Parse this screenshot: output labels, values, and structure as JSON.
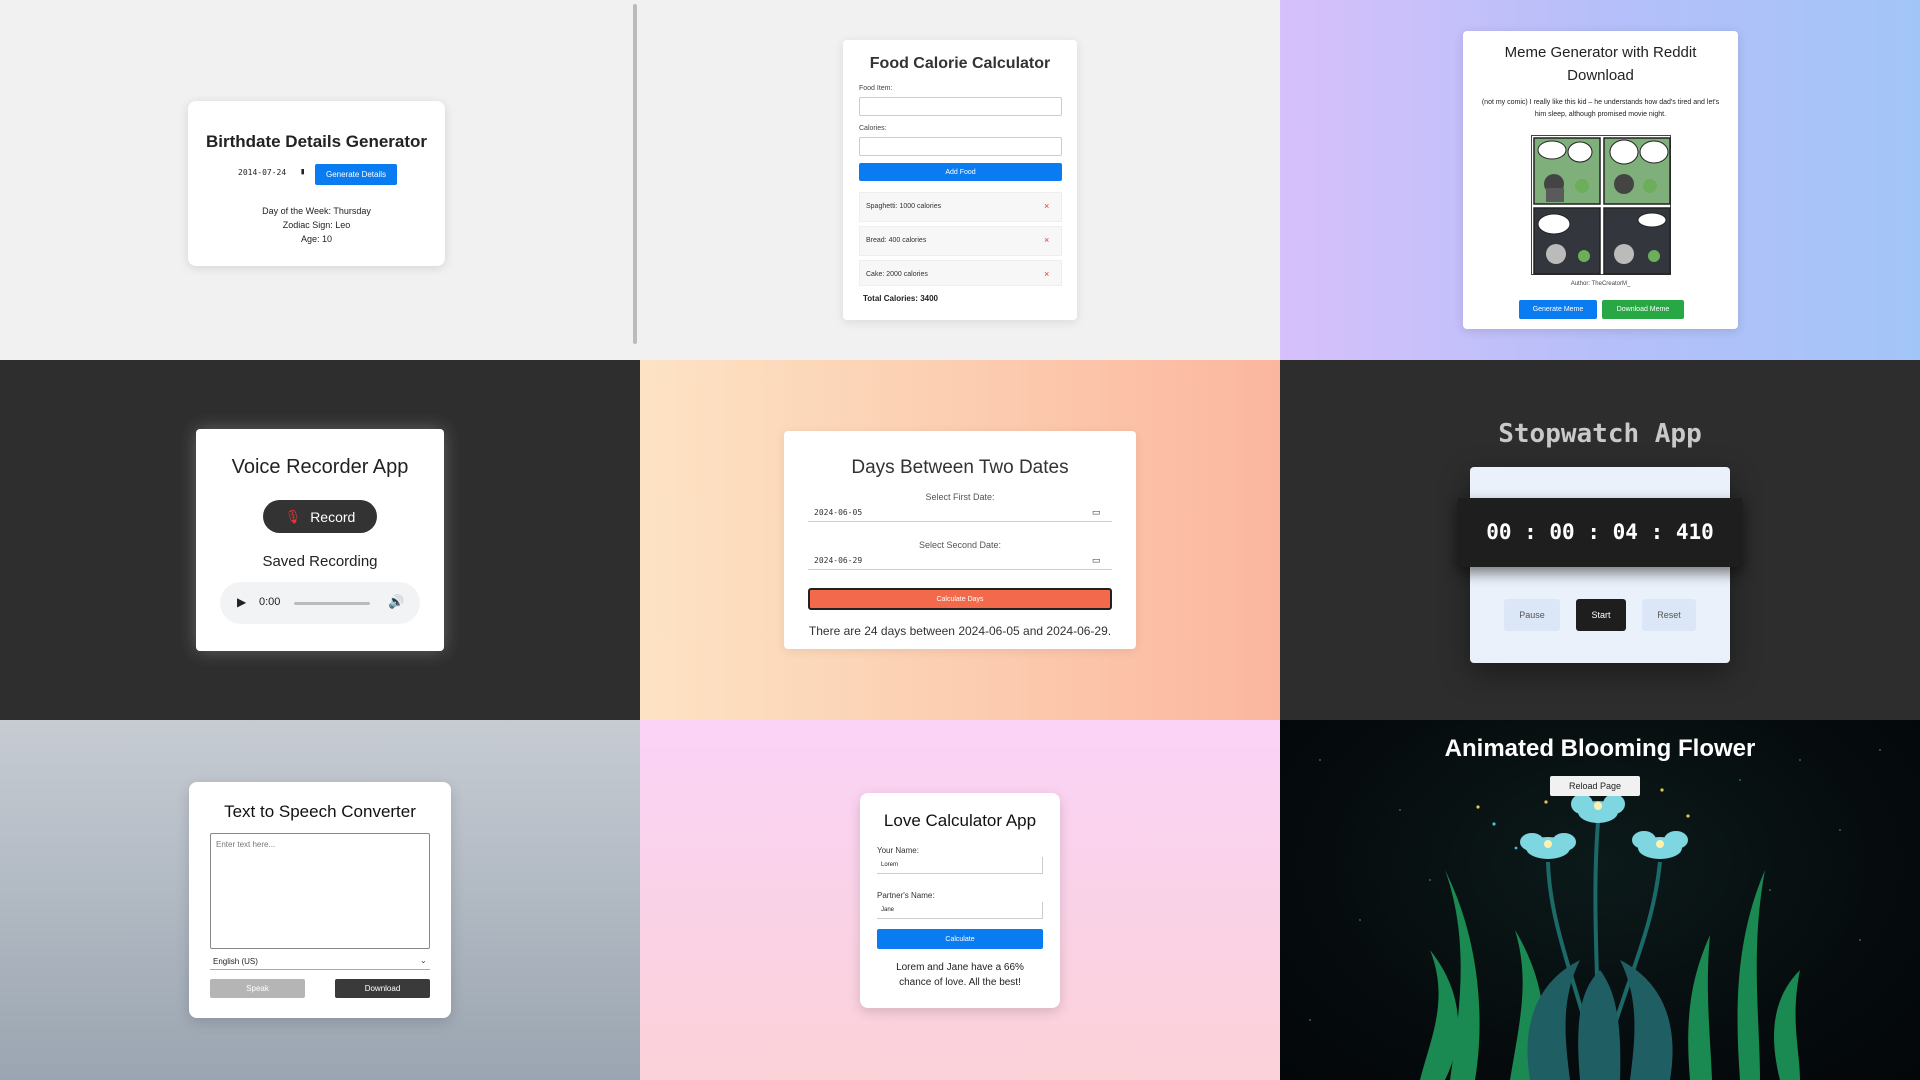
{
  "birthdate": {
    "title": "Birthdate Details Generator",
    "date_value": "2014-07-24",
    "generate_label": "Generate Details",
    "day_of_week": "Day of the Week: Thursday",
    "zodiac": "Zodiac Sign: Leo",
    "age": "Age: 10"
  },
  "calorie": {
    "title": "Food Calorie Calculator",
    "food_label": "Food Item:",
    "calories_label": "Calories:",
    "add_label": "Add Food",
    "items": [
      {
        "text": "Spaghetti: 1000 calories",
        "remove": "×"
      },
      {
        "text": "Bread: 400 calories",
        "remove": "×"
      },
      {
        "text": "Cake: 2000 calories",
        "remove": "×"
      }
    ],
    "total": "Total Calories: 3400"
  },
  "meme": {
    "title": "Meme Generator with Reddit Download",
    "caption": "(not my comic) I really like this kid – he understands how dad's tired and let's him sleep, although promised movie night.",
    "author": "Author: TheCreatorM_",
    "generate_label": "Generate Meme",
    "download_label": "Download Meme"
  },
  "voice": {
    "title": "Voice Recorder App",
    "record_label": "Record",
    "saved_label": "Saved Recording",
    "time": "0:00"
  },
  "days": {
    "title": "Days Between Two Dates",
    "first_label": "Select First Date:",
    "first_value": "2024-06-05",
    "second_label": "Select Second Date:",
    "second_value": "2024-06-29",
    "calc_label": "Calculate Days",
    "result": "There are 24 days between 2024-06-05 and 2024-06-29."
  },
  "stopwatch": {
    "title": "Stopwatch App",
    "time": "00 : 00 : 04 : 410",
    "pause_label": "Pause",
    "start_label": "Start",
    "reset_label": "Reset"
  },
  "tts": {
    "title": "Text to Speech Converter",
    "placeholder": "Enter text here...",
    "language": "English (US)",
    "speak_label": "Speak",
    "download_label": "Download"
  },
  "love": {
    "title": "Love Calculator App",
    "your_label": "Your Name:",
    "your_value": "Lorem",
    "partner_label": "Partner's Name:",
    "partner_value": "Jane",
    "calc_label": "Calculate",
    "result": "Lorem and Jane have a 66% chance of love. All the best!"
  },
  "flower": {
    "title": "Animated Blooming Flower",
    "reload_label": "Reload Page"
  },
  "colors": {
    "blue": "#0a7cf2",
    "green": "#28a745",
    "coral": "#f26a4b",
    "dark": "#2d2d2d"
  }
}
